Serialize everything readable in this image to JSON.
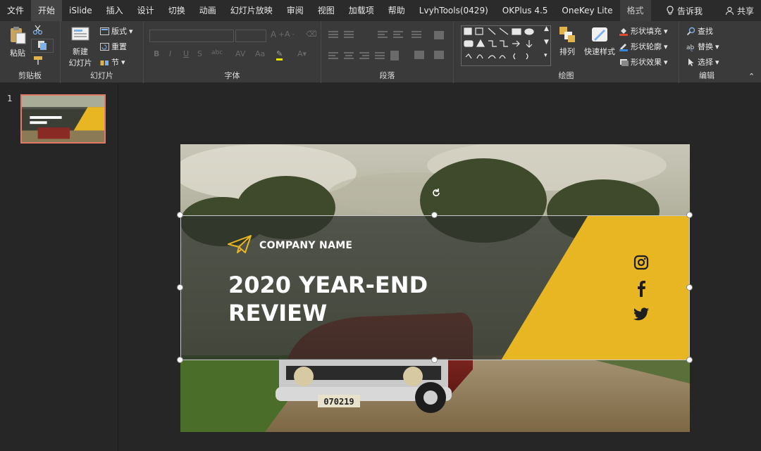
{
  "menubar": {
    "tabs": [
      "文件",
      "开始",
      "iSlide",
      "插入",
      "设计",
      "切换",
      "动画",
      "幻灯片放映",
      "审阅",
      "视图",
      "加载项",
      "帮助",
      "LvyhTools(0429)",
      "OKPlus 4.5",
      "OneKey Lite",
      "格式"
    ],
    "active_tab": "开始",
    "tell_me": "告诉我",
    "share": "共享"
  },
  "ribbon": {
    "clipboard": {
      "paste": "粘贴",
      "label": "剪贴板"
    },
    "slides": {
      "new_slide_line1": "新建",
      "new_slide_line2": "幻灯片",
      "layout": "版式",
      "reset": "重置",
      "section": "节",
      "label": "幻灯片"
    },
    "font": {
      "label": "字体",
      "bold": "B",
      "italic": "I",
      "underline": "U",
      "strike": "S",
      "shadow": "abc"
    },
    "paragraph": {
      "label": "段落"
    },
    "drawing": {
      "label": "绘图",
      "arrange": "排列",
      "quick_styles": "快速样式",
      "shape_fill": "形状填充",
      "shape_outline": "形状轮廓",
      "shape_effects": "形状效果"
    },
    "editing": {
      "label": "编辑",
      "find": "查找",
      "replace": "替换",
      "select": "选择"
    }
  },
  "thumbnail": {
    "number": "1"
  },
  "slide": {
    "company": "COMPANY NAME",
    "title_line1": "2020 YEAR-END",
    "title_line2": "REVIEW",
    "plate": "070219"
  },
  "colors": {
    "accent_yellow": "#e8b623",
    "thumb_border": "#e07a66",
    "ribbon_bg": "#3a3a3a"
  }
}
